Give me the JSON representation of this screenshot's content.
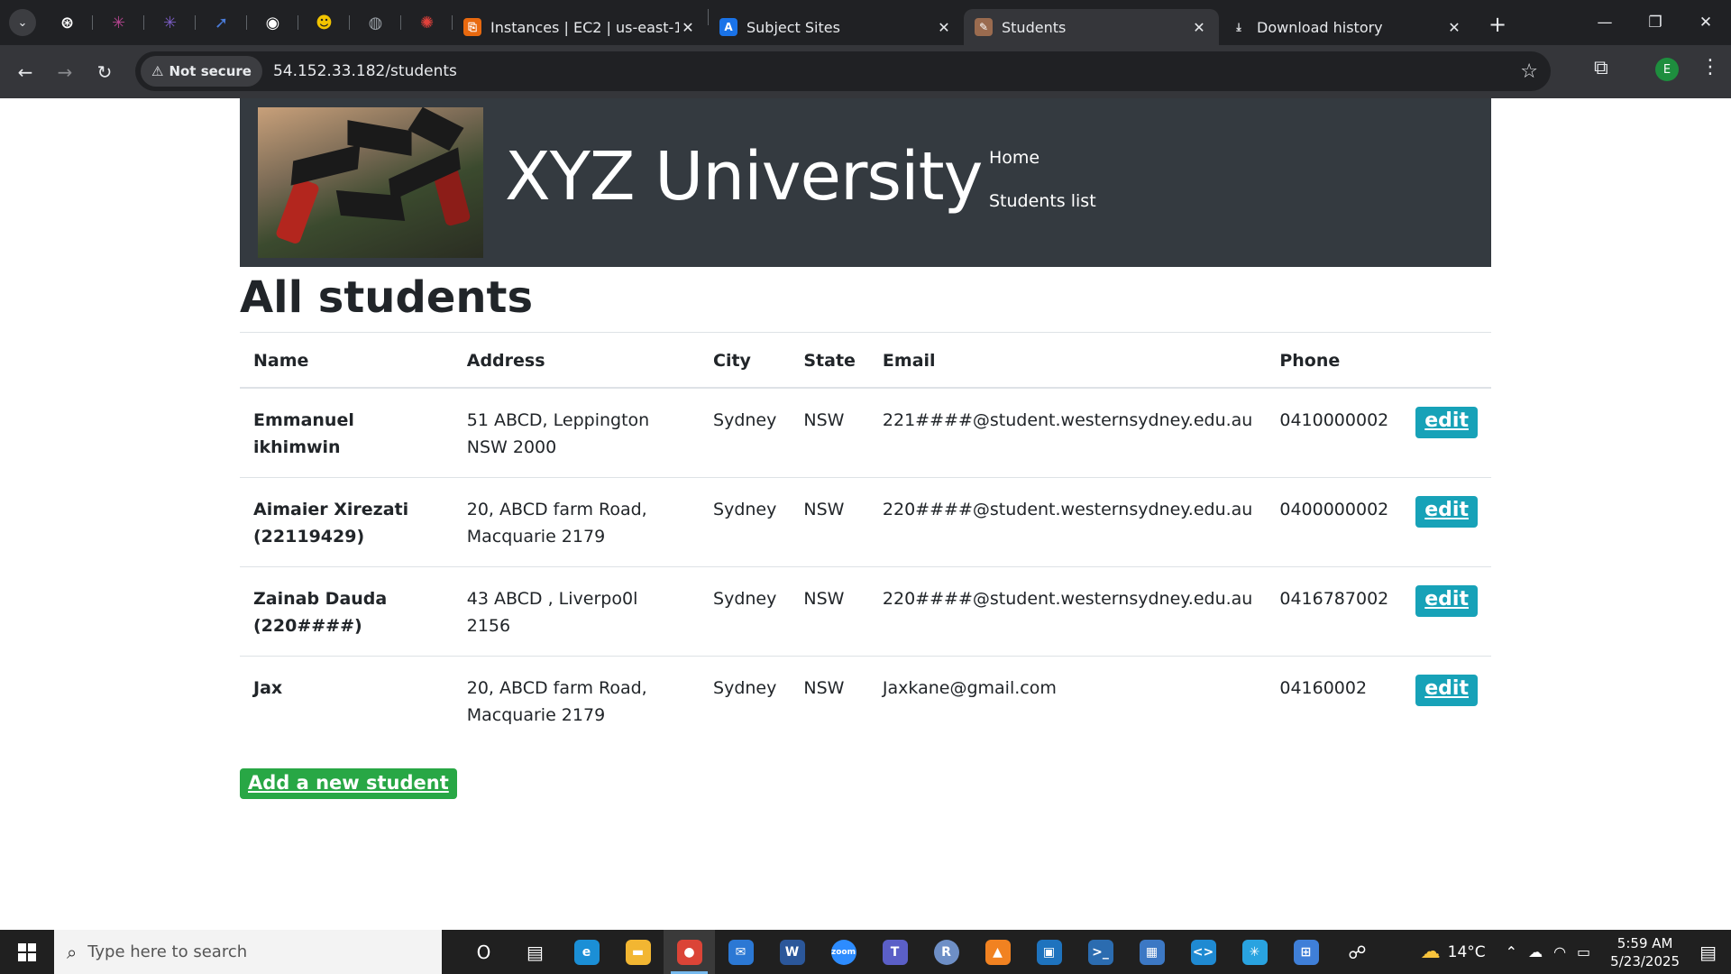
{
  "browser": {
    "tab_menu_icon": "chevron-down-icon",
    "pinned_tabs": [
      {
        "icon": "openai-icon",
        "color": "#ffffff"
      },
      {
        "icon": "asterisk-icon",
        "color": "#b4448f"
      },
      {
        "icon": "asterisk-icon",
        "color": "#7a5cc2"
      },
      {
        "icon": "rocket-icon",
        "color": "#4a7bd8"
      },
      {
        "icon": "github-icon",
        "color": "#ffffff"
      },
      {
        "icon": "face-icon",
        "color": "#f2c400"
      },
      {
        "icon": "globe-icon",
        "color": "#9aa0a6"
      },
      {
        "icon": "gear-icon",
        "color": "#e0413b"
      }
    ],
    "tabs": [
      {
        "title": "Instances | EC2 | us-east-1",
        "icon": "aws-icon",
        "color": "#e8690f",
        "active": false
      },
      {
        "title": "Subject Sites",
        "icon": "vuws-icon",
        "color": "#1a73e8",
        "active": false
      },
      {
        "title": "Students",
        "icon": "page-icon",
        "color": "#9a6b4f",
        "active": true
      },
      {
        "title": "Download history",
        "icon": "download-icon",
        "color": "#e8eaed",
        "active": false
      }
    ],
    "new_tab": "+",
    "not_secure": "Not secure",
    "url": "54.152.33.182/students",
    "profile_initial": "E"
  },
  "site": {
    "title": "XYZ University",
    "nav": [
      "Home",
      "Students list"
    ]
  },
  "page": {
    "heading": "All students",
    "columns": [
      "Name",
      "Address",
      "City",
      "State",
      "Email",
      "Phone"
    ],
    "rows": [
      {
        "name": "Emmanuel ikhimwin",
        "address": "51 ABCD, Leppington NSW 2000",
        "city": "Sydney",
        "state": "NSW",
        "email": "221####@student.westernsydney.edu.au",
        "phone": "0410000002",
        "action": "edit"
      },
      {
        "name": "Aimaier Xirezati (22119429)",
        "address": "20, ABCD farm Road, Macquarie 2179",
        "city": "Sydney",
        "state": "NSW",
        "email": "220####@student.westernsydney.edu.au",
        "phone": "0400000002",
        "action": "edit"
      },
      {
        "name": "Zainab Dauda (220####)",
        "address": "43 ABCD , Liverpo0l 2156",
        "city": "Sydney",
        "state": "NSW",
        "email": "220####@student.westernsydney.edu.au",
        "phone": "0416787002",
        "action": "edit"
      },
      {
        "name": "Jax",
        "address": "20, ABCD farm Road, Macquarie 2179",
        "city": "Sydney",
        "state": "NSW",
        "email": "Jaxkane@gmail.com",
        "phone": "04160002",
        "action": "edit"
      }
    ],
    "add_button": "Add a new student"
  },
  "taskbar": {
    "search_placeholder": "Type here to search",
    "apps": [
      {
        "icon": "cortana-icon",
        "label": "O",
        "color": "transparent"
      },
      {
        "icon": "task-view-icon",
        "label": "▤",
        "color": "transparent"
      },
      {
        "icon": "edge-icon",
        "label": "e",
        "color": "#1b8fd6"
      },
      {
        "icon": "file-explorer-icon",
        "label": "▬",
        "color": "#f2b632"
      },
      {
        "icon": "chrome-icon",
        "label": "●",
        "color": "#db4437",
        "active": true
      },
      {
        "icon": "mail-icon",
        "label": "✉",
        "color": "#2b78d4"
      },
      {
        "icon": "word-icon",
        "label": "W",
        "color": "#2b579a"
      },
      {
        "icon": "zoom-icon",
        "label": "zoom",
        "color": "#2d8cff"
      },
      {
        "icon": "teams-icon",
        "label": "T",
        "color": "#5b5fc7"
      },
      {
        "icon": "r-icon",
        "label": "R",
        "color": "#6e8fc6"
      },
      {
        "icon": "vlc-icon",
        "label": "▲",
        "color": "#f18221"
      },
      {
        "icon": "virtualbox-icon",
        "label": "▣",
        "color": "#1e73be"
      },
      {
        "icon": "terminal-icon",
        "label": ">_",
        "color": "#2b6cb0"
      },
      {
        "icon": "photos-icon",
        "label": "▦",
        "color": "#3c78c4"
      },
      {
        "icon": "vscode-icon",
        "label": "<>",
        "color": "#1f8ad2"
      },
      {
        "icon": "snowflake-icon",
        "label": "✳",
        "color": "#29a3e0"
      },
      {
        "icon": "network-icon",
        "label": "⊞",
        "color": "#3f7fd8"
      },
      {
        "icon": "people-icon",
        "label": "☍",
        "color": "transparent"
      }
    ],
    "weather": "14°C",
    "time": "5:59 AM",
    "date": "5/23/2025"
  }
}
